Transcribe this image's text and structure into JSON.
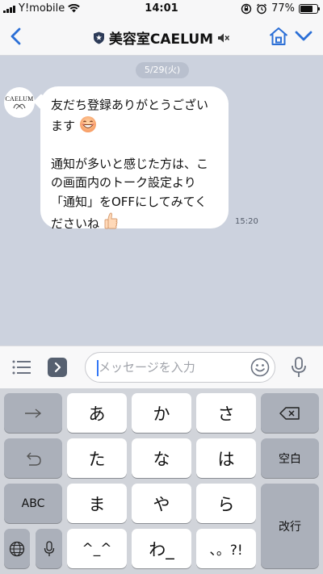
{
  "status_bar": {
    "carrier": "Y!mobile",
    "time": "14:01",
    "battery": "77%",
    "battery_level": 0.77
  },
  "header": {
    "title": "美容室CAELUM",
    "icons": [
      "back-chevron-icon",
      "shield-icon",
      "mute-icon",
      "home-icon",
      "chevron-down-icon"
    ]
  },
  "chat": {
    "date_label": "5/29(火)",
    "sender_avatar_text": "CAELUM",
    "message": {
      "lines": [
        "友だち登録ありがとうござい",
        "ます",
        "",
        "通知が多いと感じた方は、こ",
        "の画面内のトーク設定より",
        "「通知」をOFFにしてみてく",
        "ださいね"
      ],
      "emojis": [
        "grinning-face",
        "thumbs-up"
      ],
      "time": "15:20"
    }
  },
  "input_bar": {
    "placeholder": "メッセージを入力"
  },
  "keyboard": {
    "row1": [
      "あ",
      "か",
      "さ"
    ],
    "row2": [
      "た",
      "な",
      "は"
    ],
    "row3": [
      "ま",
      "や",
      "ら"
    ],
    "row4": [
      "^_^",
      "わ_",
      "、。?!"
    ],
    "abc_label": "ABC",
    "space_label": "空白",
    "return_label": "改行",
    "colors": {
      "keyboard_bg": "#d1d4da",
      "key": "#ffffff",
      "dark_key": "#abb0ba",
      "accent": "#3478f6"
    }
  }
}
